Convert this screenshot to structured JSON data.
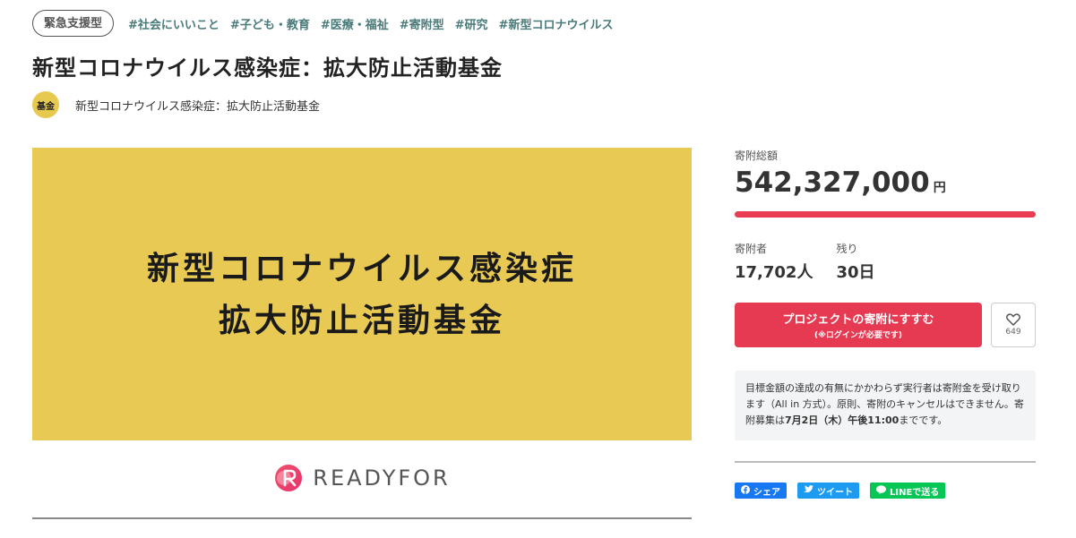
{
  "tags": {
    "badge": "緊急支援型",
    "items": [
      "#社会にいいこと",
      "#子ども・教育",
      "#医療・福祉",
      "#寄附型",
      "#研究",
      "#新型コロナウイルス"
    ]
  },
  "title": "新型コロナウイルス感染症：拡大防止活動基金",
  "owner": {
    "icon_text": "基金",
    "name": "新型コロナウイルス感染症：拡大防止活動基金"
  },
  "hero": {
    "line1": "新型コロナウイルス感染症",
    "line2": "拡大防止活動基金",
    "logo_text": "READYFOR"
  },
  "funding": {
    "total_label": "寄附総額",
    "total_value": "542,327,000",
    "total_unit": "円",
    "progress_fraction": 1.0,
    "donors_label": "寄附者",
    "donors_value": "17,702人",
    "remaining_label": "残り",
    "remaining_value": "30日"
  },
  "actions": {
    "donate_main": "プロジェクトの寄附にすすむ",
    "donate_sub": "(※ログインが必要です)",
    "favorite_count": "649"
  },
  "note": {
    "text1": "目標金額の達成の有無にかかわらず実行者は寄附金を受け取ります（All in 方式）。原則、寄附のキャンセルはできません。寄附募集は",
    "deadline": "7月2日（木）午後11:00",
    "text2": "までです。"
  },
  "share": {
    "facebook": "シェア",
    "twitter": "ツイート",
    "line": "LINEで送る"
  },
  "colors": {
    "accent": "#e63a52",
    "hero_bg": "#e7c954",
    "tag": "#4a7a7a"
  }
}
